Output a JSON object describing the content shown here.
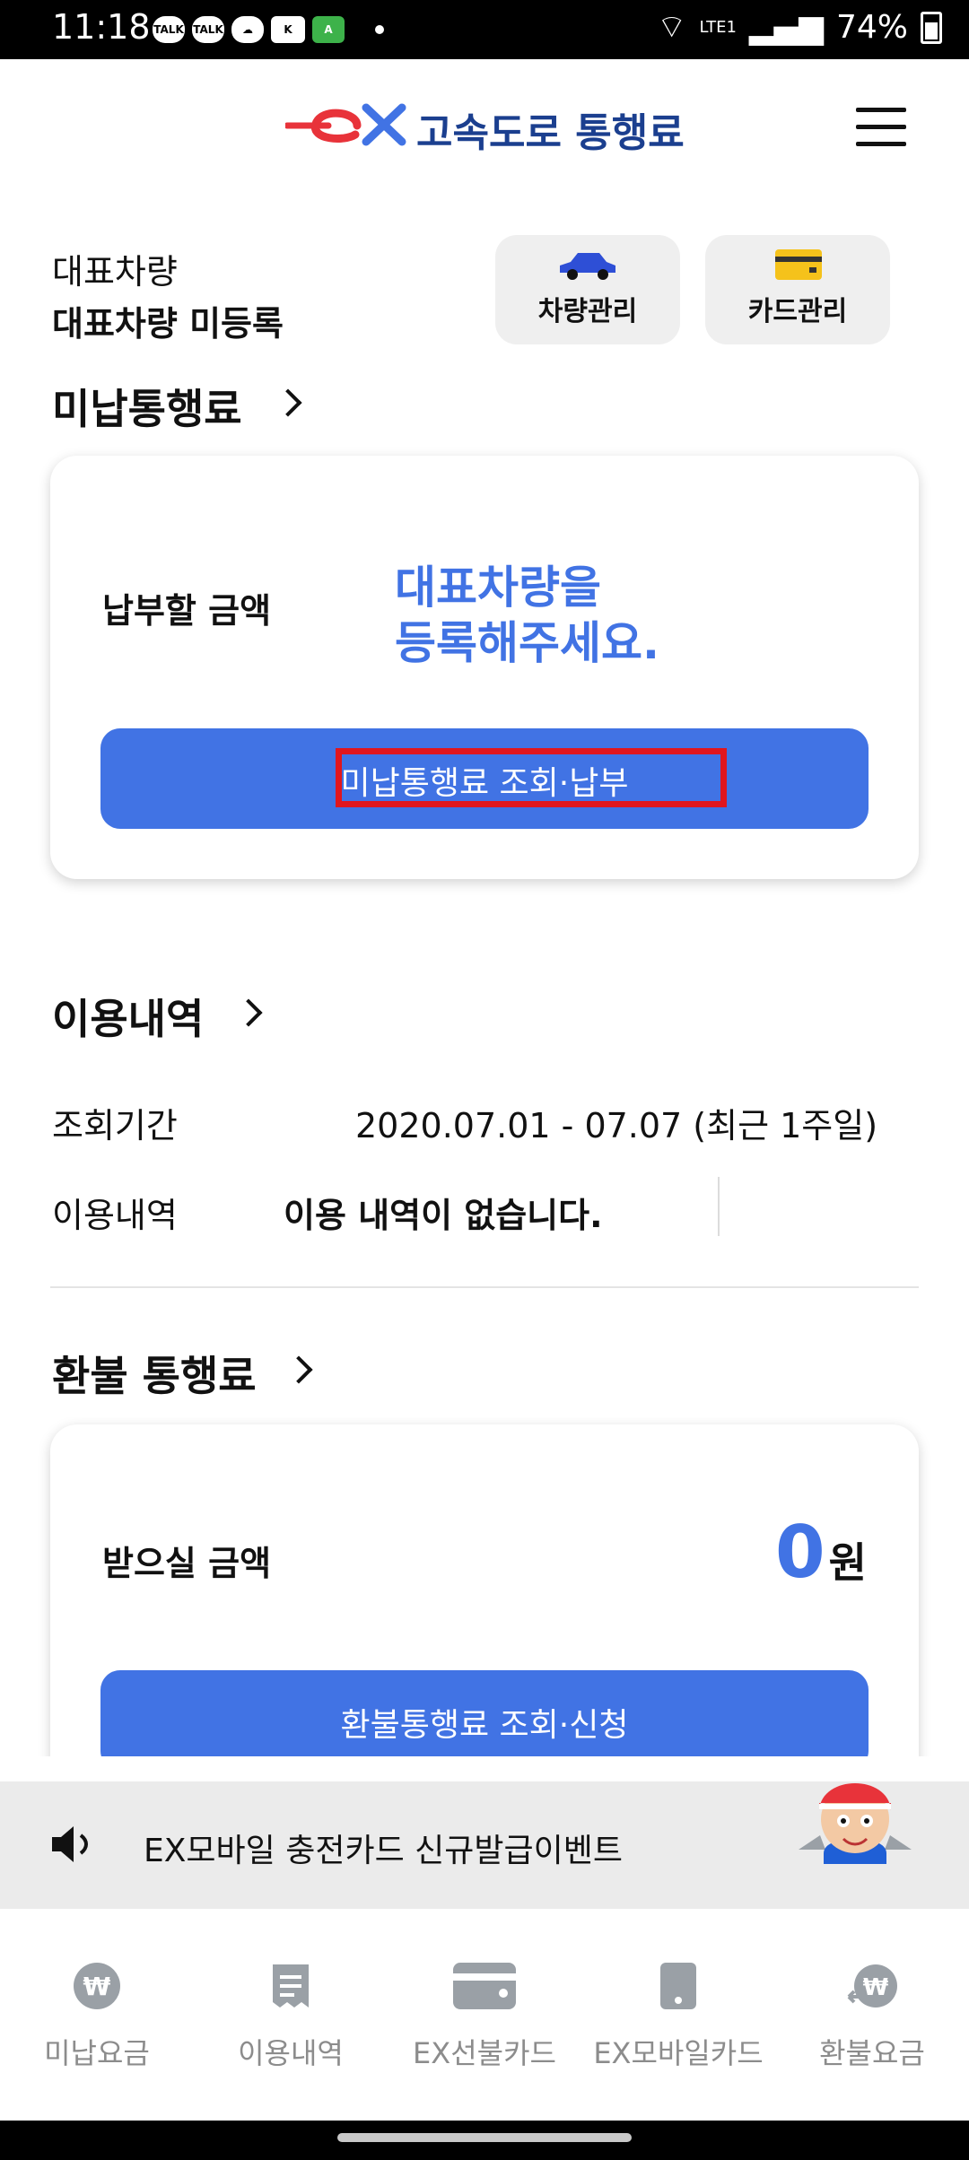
{
  "status_bar": {
    "time": "11:18",
    "battery": "74%",
    "network": "LTE1"
  },
  "header": {
    "title": "고속도로 통행료"
  },
  "vehicle": {
    "label": "대표차량",
    "value": "대표차량 미등록",
    "car_button": "차량관리",
    "card_button": "카드관리"
  },
  "unpaid": {
    "section_title": "미납통행료",
    "amount_label": "납부할 금액",
    "message_line1": "대표차량을",
    "message_line2": "등록해주세요.",
    "button": "미납통행료 조회·납부"
  },
  "usage": {
    "section_title": "이용내역",
    "period_label": "조회기간",
    "period_value": "2020.07.01 - 07.07 (최근 1주일)",
    "history_label": "이용내역",
    "history_value": "이용 내역이 없습니다."
  },
  "refund": {
    "section_title": "환불 통행료",
    "amount_label": "받으실 금액",
    "amount_value": "0",
    "amount_unit": "원",
    "button": "환불통행료 조회·신청"
  },
  "notice": {
    "text": "EX모바일 충전카드 신규발급이벤트"
  },
  "bottom_nav": [
    {
      "label": "미납요금"
    },
    {
      "label": "이용내역"
    },
    {
      "label": "EX선불카드"
    },
    {
      "label": "EX모바일카드"
    },
    {
      "label": "환불요금"
    }
  ],
  "colors": {
    "brand_blue": "#4173e4",
    "header_navy": "#1b3f8f",
    "logo_red": "#e8333a",
    "highlight_red": "#e0161e"
  }
}
